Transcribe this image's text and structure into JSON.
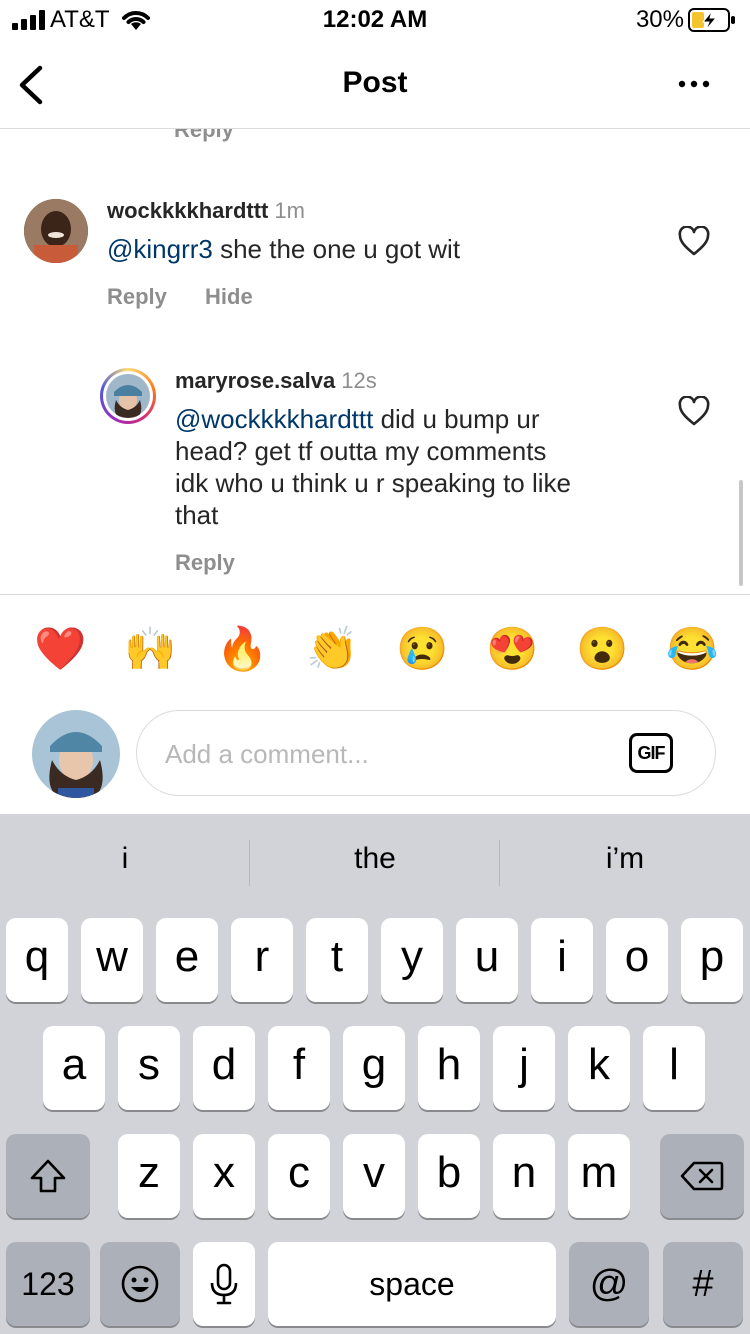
{
  "status_bar": {
    "carrier": "AT&T",
    "time": "12:02 AM",
    "battery_percent": "30%"
  },
  "nav": {
    "title": "Post"
  },
  "cut_off_reply_label": "Reply",
  "comments": [
    {
      "username": "wockkkkhardttt",
      "age": "1m",
      "mention": "@kingrr3",
      "text": " she the one u got wit",
      "actions": [
        "Reply",
        "Hide"
      ]
    },
    {
      "username": "maryrose.salva",
      "age": "12s",
      "mention": "@wockkkkhardttt",
      "text_lines": [
        " did u bump ur",
        "head? get tf outta my comments",
        "idk who u think u r speaking to like",
        "that"
      ],
      "actions": [
        "Reply"
      ]
    }
  ],
  "emoji_bar": [
    "❤️",
    "🙌",
    "🔥",
    "👏",
    "😢",
    "😍",
    "😮",
    "😂"
  ],
  "comment_input": {
    "placeholder": "Add a comment...",
    "gif_label": "GIF"
  },
  "keyboard": {
    "suggestions": [
      "i",
      "the",
      "i’m"
    ],
    "row1": [
      "q",
      "w",
      "e",
      "r",
      "t",
      "y",
      "u",
      "i",
      "o",
      "p"
    ],
    "row2": [
      "a",
      "s",
      "d",
      "f",
      "g",
      "h",
      "j",
      "k",
      "l"
    ],
    "row3": [
      "z",
      "x",
      "c",
      "v",
      "b",
      "n",
      "m"
    ],
    "numbers_label": "123",
    "space_label": "space",
    "at_label": "@",
    "hash_label": "#"
  }
}
